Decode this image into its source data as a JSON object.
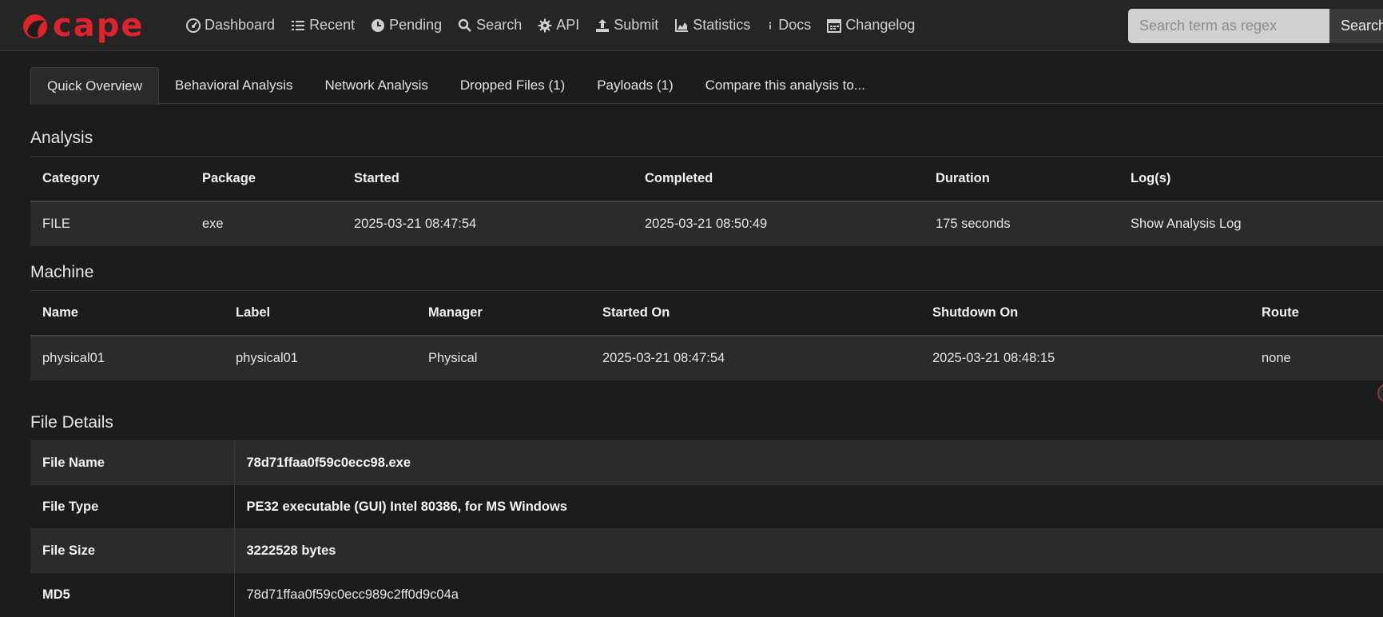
{
  "brand": {
    "name": "cape",
    "accent": "#e0222d"
  },
  "nav": {
    "items": [
      {
        "label": "Dashboard",
        "icon": "dashboard-icon"
      },
      {
        "label": "Recent",
        "icon": "list-icon"
      },
      {
        "label": "Pending",
        "icon": "clock-icon"
      },
      {
        "label": "Search",
        "icon": "search-icon"
      },
      {
        "label": "API",
        "icon": "gear-icon"
      },
      {
        "label": "Submit",
        "icon": "upload-icon"
      },
      {
        "label": "Statistics",
        "icon": "chart-icon"
      },
      {
        "label": "Docs",
        "icon": "info-icon"
      },
      {
        "label": "Changelog",
        "icon": "calendar-icon"
      }
    ],
    "search": {
      "placeholder": "Search term as regex",
      "button": "Search"
    }
  },
  "tabs": [
    {
      "label": "Quick Overview",
      "active": true
    },
    {
      "label": "Behavioral Analysis"
    },
    {
      "label": "Network Analysis"
    },
    {
      "label": "Dropped Files (1)"
    },
    {
      "label": "Payloads (1)"
    },
    {
      "label": "Compare this analysis to..."
    }
  ],
  "analysis": {
    "title": "Analysis",
    "headers": [
      "Category",
      "Package",
      "Started",
      "Completed",
      "Duration",
      "Log(s)"
    ],
    "row": [
      "FILE",
      "exe",
      "2025-03-21 08:47:54",
      "2025-03-21 08:50:49",
      "175 seconds",
      "Show Analysis Log"
    ]
  },
  "machine": {
    "title": "Machine",
    "headers": [
      "Name",
      "Label",
      "Manager",
      "Started On",
      "Shutdown On",
      "Route"
    ],
    "row": [
      "physical01",
      "physical01",
      "Physical",
      "2025-03-21 08:47:54",
      "2025-03-21 08:48:15",
      "none"
    ]
  },
  "file_details": {
    "title": "File Details",
    "rows": [
      {
        "key": "File Name",
        "value": "78d71ffaa0f59c0ecc98.exe"
      },
      {
        "key": "File Type",
        "value": "PE32 executable (GUI) Intel 80386, for MS Windows"
      },
      {
        "key": "File Size",
        "value": "3222528 bytes"
      },
      {
        "key": "MD5",
        "value": "78d71ffaa0f59c0ecc989c2ff0d9c04a"
      }
    ]
  }
}
